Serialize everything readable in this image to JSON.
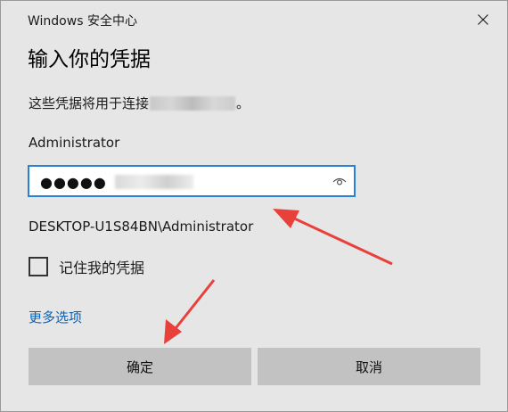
{
  "window": {
    "title": "Windows 安全中心"
  },
  "dialog": {
    "heading": "输入你的凭据",
    "description_prefix": "这些凭据将用于连接",
    "description_suffix": "。",
    "username_label": "Administrator",
    "password_dots": "●●●●●",
    "account_name": "DESKTOP-U1S84BN\\Administrator",
    "remember_label": "记住我的凭据",
    "remember_checked": false,
    "more_options": "更多选项",
    "ok_label": "确定",
    "cancel_label": "取消"
  },
  "icons": {
    "close": "close-icon",
    "reveal": "eye-icon"
  },
  "colors": {
    "input_border": "#2a7fd6",
    "link": "#0b63b6",
    "annotation": "#e8413c"
  }
}
